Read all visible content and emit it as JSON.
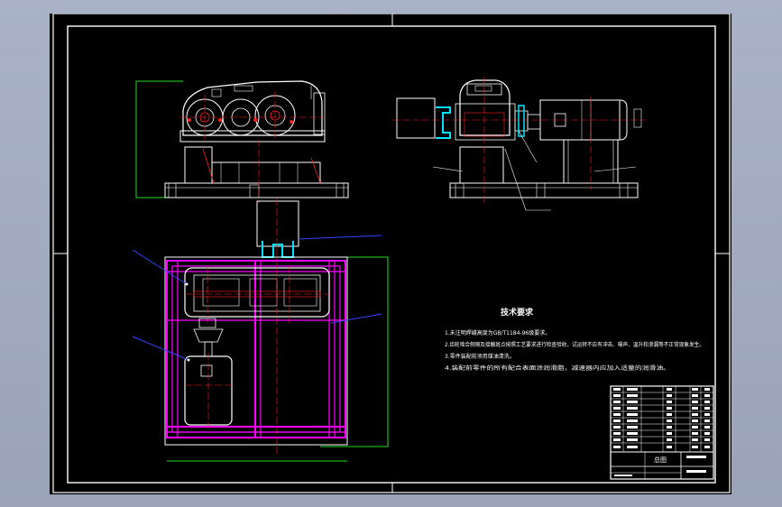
{
  "drawing": {
    "tech_requirements": {
      "title": "技术要求",
      "items": [
        "1.未注明焊缝高度为GB/T1184-96级要求。",
        "2.齿轮啮合侧隙及接触斑点按照工艺要求进行检查验收，试运转不应有冲击、噪声、温升和渗漏等不正常现象发生。",
        "3.零件装配前须用煤油清洗。",
        "4.装配前零件的所有配合表面涂润滑脂，减速器内应加入适量的润滑油。"
      ]
    },
    "title_block": {
      "drawing_name": "总图"
    },
    "colors": {
      "background": "#000000",
      "frame": "#ffffff",
      "red": "#ff2020",
      "green": "#22dd22",
      "magenta": "#ff00ff",
      "cyan": "#00e5ff",
      "blue": "#3344ff",
      "yellow": "#ffff00"
    }
  }
}
